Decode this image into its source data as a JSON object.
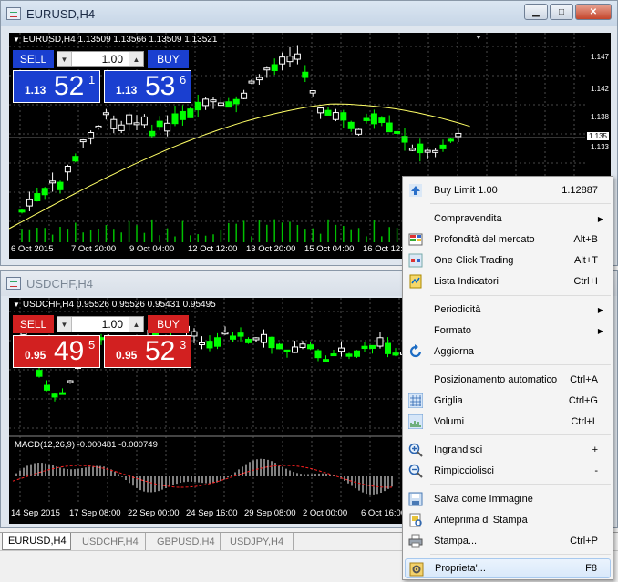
{
  "windows": [
    {
      "title": "EURUSD,H4",
      "symbol_info": "EURUSD,H4  1.13509 1.13566 1.13509 1.13521",
      "sell_label": "SELL",
      "buy_label": "BUY",
      "lot": "1.00",
      "bid_small": "1.13",
      "bid_big": "52",
      "bid_sup": "1",
      "ask_small": "1.13",
      "ask_big": "53",
      "ask_sup": "6",
      "y_ticks": [
        "1.147",
        "1.142",
        "1.138",
        "1.135",
        "1.133"
      ],
      "price_tag": "1.135",
      "x_ticks": [
        "6 Oct 2015",
        "7 Oct 20:00",
        "9 Oct 04:00",
        "12 Oct 12:00",
        "13 Oct 20:00",
        "15 Oct 04:00",
        "16 Oct 12:"
      ]
    },
    {
      "title": "USDCHF,H4",
      "symbol_info": "USDCHF,H4  0.95526 0.95526 0.95431 0.95495",
      "sell_label": "SELL",
      "buy_label": "BUY",
      "lot": "1.00",
      "bid_small": "0.95",
      "bid_big": "49",
      "bid_sup": "5",
      "ask_small": "0.95",
      "ask_big": "52",
      "ask_sup": "3",
      "macd_label": "MACD(12,26,9) -0.000481 -0.000749",
      "x_ticks": [
        "14 Sep 2015",
        "17 Sep 08:00",
        "22 Sep 00:00",
        "24 Sep 16:00",
        "29 Sep 08:00",
        "2 Oct 00:00",
        "6 Oct 16:00"
      ]
    }
  ],
  "tabs": [
    "EURUSD,H4",
    "USDCHF,H4",
    "GBPUSD,H4",
    "USDJPY,H4"
  ],
  "menu": {
    "items": [
      {
        "label": "Buy Limit 1.00",
        "shortcut": "1.12887",
        "icon": "arrow-up-icon"
      },
      {
        "label": "Compravendita",
        "shortcut": "",
        "icon": "",
        "submenu": true
      },
      {
        "label": "Profondità del mercato",
        "shortcut": "Alt+B",
        "icon": "depth-grid-icon"
      },
      {
        "label": "One Click Trading",
        "shortcut": "Alt+T",
        "icon": "one-click-icon"
      },
      {
        "label": "Lista Indicatori",
        "shortcut": "Ctrl+I",
        "icon": "indicator-list-icon"
      },
      {
        "label": "Periodicità",
        "shortcut": "",
        "icon": "",
        "submenu": true
      },
      {
        "label": "Formato",
        "shortcut": "",
        "icon": "",
        "submenu": true
      },
      {
        "label": "Aggiorna",
        "shortcut": "",
        "icon": "refresh-icon"
      },
      {
        "label": "Posizionamento automatico",
        "shortcut": "Ctrl+A",
        "icon": ""
      },
      {
        "label": "Griglia",
        "shortcut": "Ctrl+G",
        "icon": "grid-icon"
      },
      {
        "label": "Volumi",
        "shortcut": "Ctrl+L",
        "icon": "volumes-icon"
      },
      {
        "label": "Ingrandisci",
        "shortcut": "+",
        "icon": "zoom-in-icon"
      },
      {
        "label": "Rimpicciolisci",
        "shortcut": "-",
        "icon": "zoom-out-icon"
      },
      {
        "label": "Salva come Immagine",
        "shortcut": "",
        "icon": "save-image-icon"
      },
      {
        "label": "Anteprima di Stampa",
        "shortcut": "",
        "icon": "print-preview-icon"
      },
      {
        "label": "Stampa...",
        "shortcut": "Ctrl+P",
        "icon": "print-icon"
      },
      {
        "label": "Proprieta'...",
        "shortcut": "F8",
        "icon": "properties-icon"
      }
    ]
  },
  "colors": {
    "buy_panel": "#1a3fd0",
    "sell_panel": "#d22020",
    "bull_candle": "#ffffff",
    "bear_candle": "#00ff00",
    "moving_average": "#ffff66",
    "macd_signal": "#ff2020",
    "menu_highlight": "#d9e9fa"
  }
}
